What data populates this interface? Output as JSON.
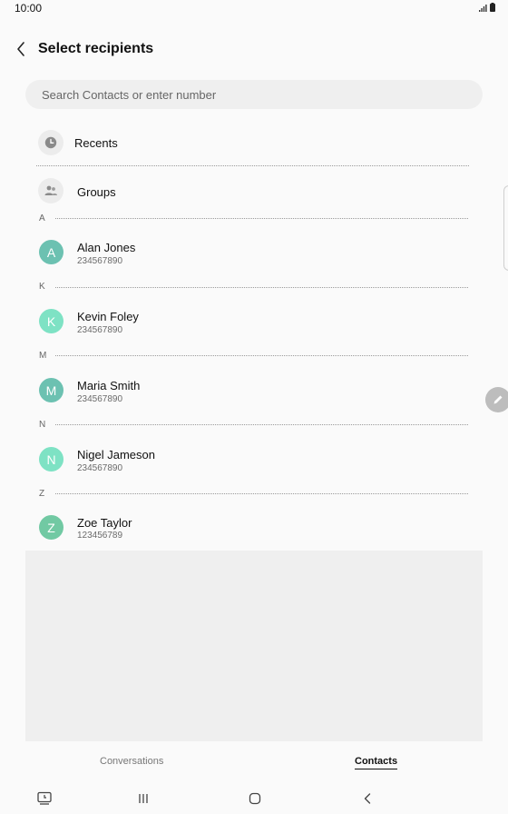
{
  "status": {
    "time": "10:00"
  },
  "header": {
    "title": "Select recipients"
  },
  "search": {
    "placeholder": "Search Contacts or enter number"
  },
  "shortcuts": {
    "recents_label": "Recents",
    "groups_label": "Groups"
  },
  "sections": [
    {
      "letter": "A",
      "name": "Alan Jones",
      "number": "234567890",
      "initial": "A",
      "avatar_color": "#6cc1b1"
    },
    {
      "letter": "K",
      "name": "Kevin Foley",
      "number": "234567890",
      "initial": "K",
      "avatar_color": "#7ee2c4"
    },
    {
      "letter": "M",
      "name": "Maria Smith",
      "number": "234567890",
      "initial": "M",
      "avatar_color": "#6cc1b1"
    },
    {
      "letter": "N",
      "name": "Nigel Jameson",
      "number": "234567890",
      "initial": "N",
      "avatar_color": "#7ee2c4"
    },
    {
      "letter": "Z",
      "name": "Zoe Taylor",
      "number": "123456789",
      "initial": "Z",
      "avatar_color": "#71c9a3"
    }
  ],
  "tabs": {
    "conversations": "Conversations",
    "contacts": "Contacts",
    "active": "contacts"
  },
  "icons": {
    "back": "chevron-left-icon",
    "recents": "clock-icon",
    "groups": "people-icon",
    "fab": "pencil-icon"
  }
}
